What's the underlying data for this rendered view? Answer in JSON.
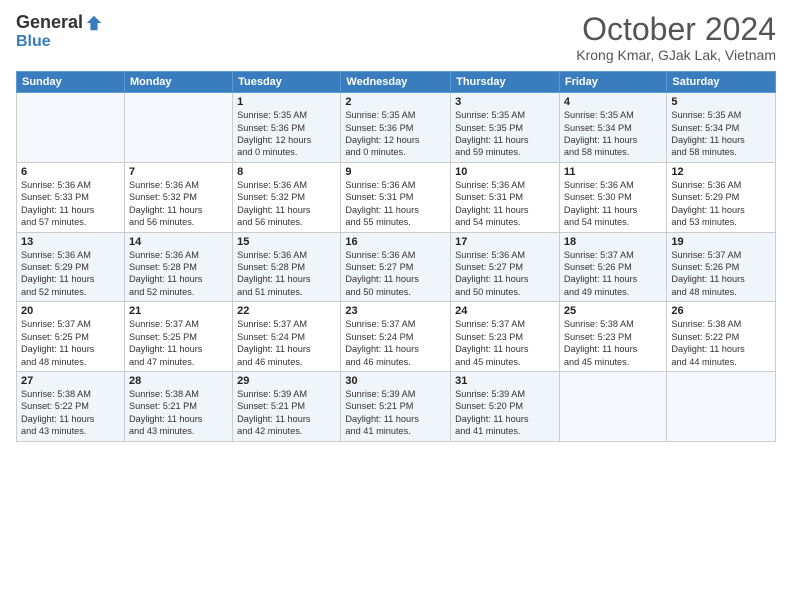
{
  "header": {
    "logo_general": "General",
    "logo_blue": "Blue",
    "month": "October 2024",
    "location": "Krong Kmar, GJak Lak, Vietnam"
  },
  "weekdays": [
    "Sunday",
    "Monday",
    "Tuesday",
    "Wednesday",
    "Thursday",
    "Friday",
    "Saturday"
  ],
  "weeks": [
    [
      {
        "day": "",
        "info": ""
      },
      {
        "day": "",
        "info": ""
      },
      {
        "day": "1",
        "info": "Sunrise: 5:35 AM\nSunset: 5:36 PM\nDaylight: 12 hours\nand 0 minutes."
      },
      {
        "day": "2",
        "info": "Sunrise: 5:35 AM\nSunset: 5:36 PM\nDaylight: 12 hours\nand 0 minutes."
      },
      {
        "day": "3",
        "info": "Sunrise: 5:35 AM\nSunset: 5:35 PM\nDaylight: 11 hours\nand 59 minutes."
      },
      {
        "day": "4",
        "info": "Sunrise: 5:35 AM\nSunset: 5:34 PM\nDaylight: 11 hours\nand 58 minutes."
      },
      {
        "day": "5",
        "info": "Sunrise: 5:35 AM\nSunset: 5:34 PM\nDaylight: 11 hours\nand 58 minutes."
      }
    ],
    [
      {
        "day": "6",
        "info": "Sunrise: 5:36 AM\nSunset: 5:33 PM\nDaylight: 11 hours\nand 57 minutes."
      },
      {
        "day": "7",
        "info": "Sunrise: 5:36 AM\nSunset: 5:32 PM\nDaylight: 11 hours\nand 56 minutes."
      },
      {
        "day": "8",
        "info": "Sunrise: 5:36 AM\nSunset: 5:32 PM\nDaylight: 11 hours\nand 56 minutes."
      },
      {
        "day": "9",
        "info": "Sunrise: 5:36 AM\nSunset: 5:31 PM\nDaylight: 11 hours\nand 55 minutes."
      },
      {
        "day": "10",
        "info": "Sunrise: 5:36 AM\nSunset: 5:31 PM\nDaylight: 11 hours\nand 54 minutes."
      },
      {
        "day": "11",
        "info": "Sunrise: 5:36 AM\nSunset: 5:30 PM\nDaylight: 11 hours\nand 54 minutes."
      },
      {
        "day": "12",
        "info": "Sunrise: 5:36 AM\nSunset: 5:29 PM\nDaylight: 11 hours\nand 53 minutes."
      }
    ],
    [
      {
        "day": "13",
        "info": "Sunrise: 5:36 AM\nSunset: 5:29 PM\nDaylight: 11 hours\nand 52 minutes."
      },
      {
        "day": "14",
        "info": "Sunrise: 5:36 AM\nSunset: 5:28 PM\nDaylight: 11 hours\nand 52 minutes."
      },
      {
        "day": "15",
        "info": "Sunrise: 5:36 AM\nSunset: 5:28 PM\nDaylight: 11 hours\nand 51 minutes."
      },
      {
        "day": "16",
        "info": "Sunrise: 5:36 AM\nSunset: 5:27 PM\nDaylight: 11 hours\nand 50 minutes."
      },
      {
        "day": "17",
        "info": "Sunrise: 5:36 AM\nSunset: 5:27 PM\nDaylight: 11 hours\nand 50 minutes."
      },
      {
        "day": "18",
        "info": "Sunrise: 5:37 AM\nSunset: 5:26 PM\nDaylight: 11 hours\nand 49 minutes."
      },
      {
        "day": "19",
        "info": "Sunrise: 5:37 AM\nSunset: 5:26 PM\nDaylight: 11 hours\nand 48 minutes."
      }
    ],
    [
      {
        "day": "20",
        "info": "Sunrise: 5:37 AM\nSunset: 5:25 PM\nDaylight: 11 hours\nand 48 minutes."
      },
      {
        "day": "21",
        "info": "Sunrise: 5:37 AM\nSunset: 5:25 PM\nDaylight: 11 hours\nand 47 minutes."
      },
      {
        "day": "22",
        "info": "Sunrise: 5:37 AM\nSunset: 5:24 PM\nDaylight: 11 hours\nand 46 minutes."
      },
      {
        "day": "23",
        "info": "Sunrise: 5:37 AM\nSunset: 5:24 PM\nDaylight: 11 hours\nand 46 minutes."
      },
      {
        "day": "24",
        "info": "Sunrise: 5:37 AM\nSunset: 5:23 PM\nDaylight: 11 hours\nand 45 minutes."
      },
      {
        "day": "25",
        "info": "Sunrise: 5:38 AM\nSunset: 5:23 PM\nDaylight: 11 hours\nand 45 minutes."
      },
      {
        "day": "26",
        "info": "Sunrise: 5:38 AM\nSunset: 5:22 PM\nDaylight: 11 hours\nand 44 minutes."
      }
    ],
    [
      {
        "day": "27",
        "info": "Sunrise: 5:38 AM\nSunset: 5:22 PM\nDaylight: 11 hours\nand 43 minutes."
      },
      {
        "day": "28",
        "info": "Sunrise: 5:38 AM\nSunset: 5:21 PM\nDaylight: 11 hours\nand 43 minutes."
      },
      {
        "day": "29",
        "info": "Sunrise: 5:39 AM\nSunset: 5:21 PM\nDaylight: 11 hours\nand 42 minutes."
      },
      {
        "day": "30",
        "info": "Sunrise: 5:39 AM\nSunset: 5:21 PM\nDaylight: 11 hours\nand 41 minutes."
      },
      {
        "day": "31",
        "info": "Sunrise: 5:39 AM\nSunset: 5:20 PM\nDaylight: 11 hours\nand 41 minutes."
      },
      {
        "day": "",
        "info": ""
      },
      {
        "day": "",
        "info": ""
      }
    ]
  ]
}
